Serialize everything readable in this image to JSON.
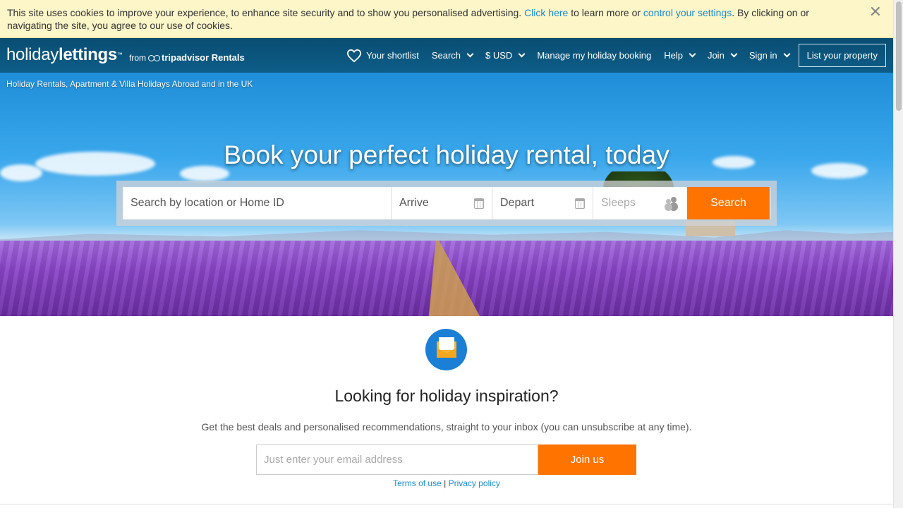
{
  "cookie_banner": {
    "text_before": "This site uses cookies to improve your experience, to enhance site security and to show you personalised advertising. ",
    "link1": "Click here",
    "text_middle": " to learn more or ",
    "link2": "control your settings",
    "text_after": ". By clicking on or navigating the site, you agree to our use of cookies.",
    "close": "✕"
  },
  "header": {
    "logo_light": "holiday",
    "logo_bold": "lettings",
    "logo_tm": "™",
    "from": "from",
    "partner": "tripadvisor Rentals",
    "nav": {
      "shortlist": "Your shortlist",
      "search": "Search",
      "currency": "$ USD",
      "manage": "Manage my holiday booking",
      "help": "Help",
      "join": "Join",
      "signin": "Sign in",
      "list_property": "List your property"
    }
  },
  "hero": {
    "tagline": "Holiday Rentals, Apartment & Villa Holidays Abroad and in the UK",
    "title": "Book your perfect holiday rental, today",
    "search": {
      "location_placeholder": "Search by location or Home ID",
      "arrive": "Arrive",
      "depart": "Depart",
      "sleeps": "Sleeps",
      "button": "Search"
    }
  },
  "newsletter": {
    "title": "Looking for holiday inspiration?",
    "subtitle": "Get the best deals and personalised recommendations, straight to your inbox (you can unsubscribe at any time).",
    "email_placeholder": "Just enter your email address",
    "button": "Join us",
    "terms": "Terms of use",
    "separator": "|",
    "privacy": "Privacy policy"
  },
  "colors": {
    "accent_orange": "#ff7300",
    "header_blue": "#0c5d88",
    "link_blue": "#1a8cd8",
    "cookie_bg": "#fdf6c9"
  }
}
